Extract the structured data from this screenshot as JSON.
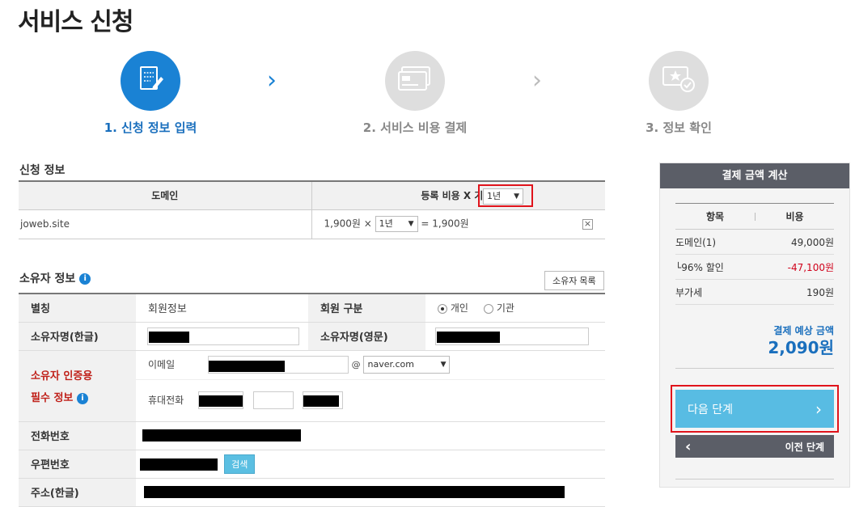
{
  "page": {
    "title": "서비스 신청"
  },
  "steps": [
    {
      "label": "1. 신청 정보 입력",
      "icon": "form-edit-icon",
      "state": "active"
    },
    {
      "label": "2. 서비스 비용 결제",
      "icon": "credit-card-icon",
      "state": "inactive"
    },
    {
      "label": "3. 정보 확인",
      "icon": "certificate-check-icon",
      "state": "inactive"
    }
  ],
  "application": {
    "title": "신청 정보",
    "col_domain": "도메인",
    "col_fee": "등록 비용 X 기간:",
    "period_header_value": "1년",
    "row": {
      "domain": "joweb.site",
      "price": "1,900원 ×",
      "period": "1년",
      "total": "= 1,900원",
      "remove": "×"
    }
  },
  "owner": {
    "title": "소유자 정보",
    "list_button": "소유자 목록",
    "nickname_label": "별칭",
    "nickname_value": "회원정보",
    "member_type_label": "회원 구분",
    "member_type_options": [
      "개인",
      "기관"
    ],
    "member_type_selected": "개인",
    "name_ko_label": "소유자명(한글)",
    "name_en_label": "소유자명(영문)",
    "auth_label_1": "소유자 인증용",
    "auth_label_2": "필수 정보",
    "email_label": "이메일",
    "email_at": "@",
    "email_domain": "naver.com",
    "mobile_label": "휴대전화",
    "phone_label": "전화번호",
    "zip_label": "우편번호",
    "search_button": "검색",
    "address_label": "주소(한글)"
  },
  "payment": {
    "title": "결제 금액 계산",
    "col_item": "항목",
    "col_cost": "비용",
    "rows": [
      {
        "item": "도메인(1)",
        "cost": "49,000원",
        "color": "#444444"
      },
      {
        "item": "└96% 할인",
        "cost": "-47,100원",
        "color": "#d0021b"
      },
      {
        "item": "부가세",
        "cost": "190원",
        "color": "#444444"
      }
    ],
    "estimate_label": "결제 예상 금액",
    "estimate_value": "2,090원",
    "next_button": "다음 단계",
    "prev_button": "이전 단계"
  }
}
